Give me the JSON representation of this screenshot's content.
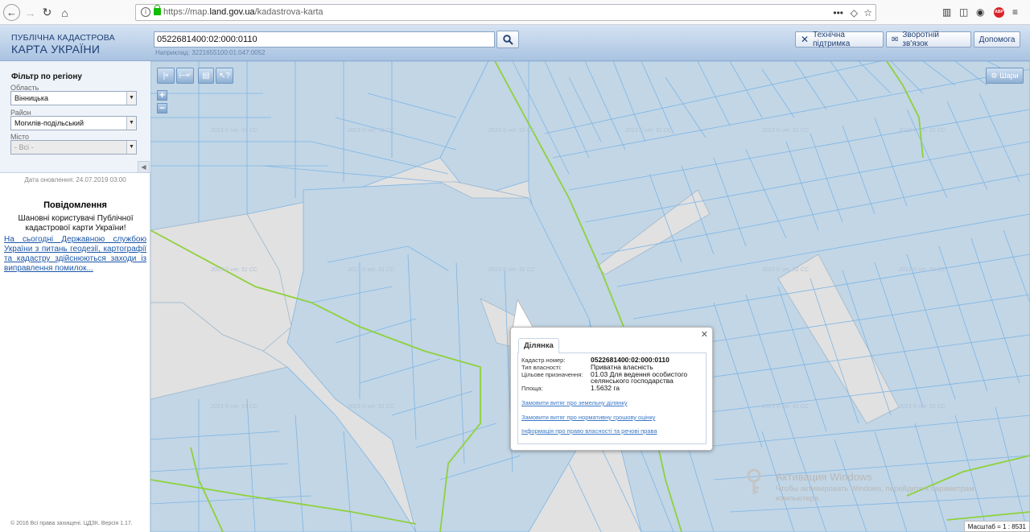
{
  "browser": {
    "url_prefix": "https://map.",
    "url_domain": "land.gov.ua",
    "url_path": "/kadastrova-karta",
    "more_icon": "•••"
  },
  "header": {
    "logo_line1": "ПУБЛІЧНА КАДАСТРОВА",
    "logo_line2": "КАРТА УКРАЇНИ",
    "search_value": "0522681400:02:000:0110",
    "hint": "Наприклад: 3221655100:01:047:0052",
    "btn_support": "Технічна підтримка",
    "btn_feedback": "Зворотній зв'язок",
    "btn_help": "Допомога"
  },
  "sidebar": {
    "filter_title": "Фільтр по регіону",
    "oblast_label": "Область",
    "oblast_value": "Вінницька",
    "raion_label": "Район",
    "raion_value": "Могилів-подільський",
    "city_label": "Місто",
    "city_value": "- Всі -",
    "updated": "Дата оновлення: 24.07.2019 03:00",
    "msg_title": "Повідомлення",
    "msg_body": "Шановні користувачі Публічної кадастрової карти України!",
    "msg_link": "На сьогодні Державною службою України з питань геодезії, картографії та кадастру здійснюються заходи із виправлення помилок...",
    "copyright": "© 2016 Всі права захищені. ЦДЗК. Версія 1.17."
  },
  "map": {
    "tool_ruler": "м",
    "tool_area": "м²",
    "layers": "Шари",
    "zoom_in": "+",
    "zoom_out": "−",
    "watermark": "2013 © ver. 51 СС",
    "scale": "Масштаб = 1 : 8531"
  },
  "popup": {
    "tab": "Ділянка",
    "k_cad": "Кадастр.номер:",
    "v_cad": "0522681400:02:000:0110",
    "k_type": "Тип власності:",
    "v_type": "Приватна власність",
    "k_purpose": "Цільове призначення:",
    "v_purpose": "01.03 Для ведення особистого селянського господарства",
    "k_area": "Площа:",
    "v_area": "1.5632 га",
    "link1": "Замовити витяг про земельну ділянку",
    "link2": "Замовити витяг про нормативну грошову оцінку",
    "link3": "Інформація про право власності та речові права"
  },
  "activation": {
    "title": "Активация Windows",
    "text": "Чтобы активировать Windows, перейдите к параметрам компьютера."
  }
}
